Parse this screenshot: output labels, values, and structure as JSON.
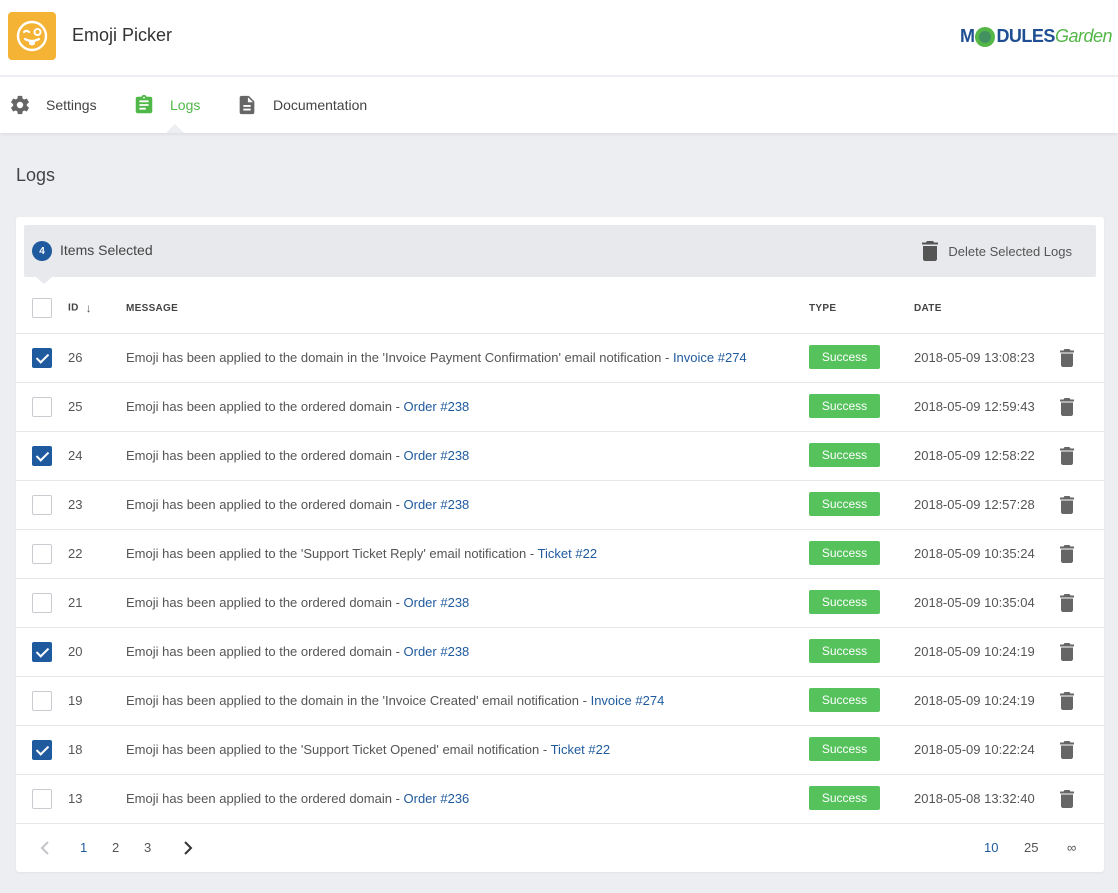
{
  "app": {
    "title": "Emoji Picker"
  },
  "brand": {
    "part1": "M",
    "part2": "DULES",
    "part3": "Garden"
  },
  "tabs": [
    {
      "label": "Settings",
      "icon": "gear-icon"
    },
    {
      "label": "Logs",
      "icon": "clipboard-icon",
      "active": true
    },
    {
      "label": "Documentation",
      "icon": "document-icon"
    }
  ],
  "page": {
    "title": "Logs"
  },
  "selection": {
    "count": "4",
    "label": "Items Selected",
    "delete_label": "Delete Selected Logs"
  },
  "table": {
    "headers": {
      "id": "ID",
      "message": "MESSAGE",
      "type": "TYPE",
      "date": "DATE"
    },
    "rows": [
      {
        "checked": true,
        "id": "26",
        "message": "Emoji has been applied to the domain in the 'Invoice Payment Confirmation' email notification - ",
        "link": "Invoice #274",
        "type": "Success",
        "date": "2018-05-09 13:08:23"
      },
      {
        "checked": false,
        "id": "25",
        "message": "Emoji has been applied to the ordered domain - ",
        "link": "Order #238",
        "type": "Success",
        "date": "2018-05-09 12:59:43"
      },
      {
        "checked": true,
        "id": "24",
        "message": "Emoji has been applied to the ordered domain - ",
        "link": "Order #238",
        "type": "Success",
        "date": "2018-05-09 12:58:22"
      },
      {
        "checked": false,
        "id": "23",
        "message": "Emoji has been applied to the ordered domain - ",
        "link": "Order #238",
        "type": "Success",
        "date": "2018-05-09 12:57:28"
      },
      {
        "checked": false,
        "id": "22",
        "message": "Emoji has been applied to the 'Support Ticket Reply' email notification - ",
        "link": "Ticket #22",
        "type": "Success",
        "date": "2018-05-09 10:35:24"
      },
      {
        "checked": false,
        "id": "21",
        "message": "Emoji has been applied to the ordered domain - ",
        "link": "Order #238",
        "type": "Success",
        "date": "2018-05-09 10:35:04"
      },
      {
        "checked": true,
        "id": "20",
        "message": "Emoji has been applied to the ordered domain - ",
        "link": "Order #238",
        "type": "Success",
        "date": "2018-05-09 10:24:19"
      },
      {
        "checked": false,
        "id": "19",
        "message": "Emoji has been applied to the domain in the 'Invoice Created' email notification - ",
        "link": "Invoice #274",
        "type": "Success",
        "date": "2018-05-09 10:24:19"
      },
      {
        "checked": true,
        "id": "18",
        "message": "Emoji has been applied to the 'Support Ticket Opened' email notification - ",
        "link": "Ticket #22",
        "type": "Success",
        "date": "2018-05-09 10:22:24"
      },
      {
        "checked": false,
        "id": "13",
        "message": "Emoji has been applied to the ordered domain - ",
        "link": "Order #236",
        "type": "Success",
        "date": "2018-05-08 13:32:40"
      }
    ]
  },
  "pagination": {
    "pages": [
      "1",
      "2",
      "3"
    ],
    "current": "1",
    "per_page": [
      "10",
      "25",
      "∞"
    ],
    "per_page_current": "10"
  },
  "colors": {
    "accent": "#1f5a9e",
    "success": "#55c25c",
    "tab_active": "#4fb848",
    "app_icon": "#f5b335"
  }
}
